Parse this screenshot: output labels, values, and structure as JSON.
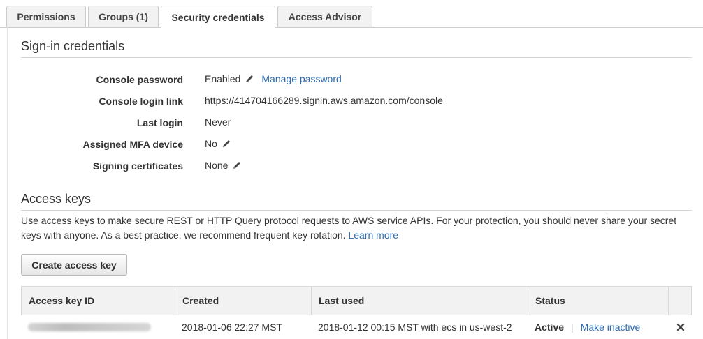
{
  "tabs": [
    {
      "label": "Permissions",
      "active": false
    },
    {
      "label": "Groups (1)",
      "active": false
    },
    {
      "label": "Security credentials",
      "active": true
    },
    {
      "label": "Access Advisor",
      "active": false
    }
  ],
  "signin": {
    "title": "Sign-in credentials",
    "console_password_label": "Console password",
    "console_password_value": "Enabled",
    "manage_password_link": "Manage password",
    "console_login_link_label": "Console login link",
    "console_login_link_value": "https://414704166289.signin.aws.amazon.com/console",
    "last_login_label": "Last login",
    "last_login_value": "Never",
    "mfa_label": "Assigned MFA device",
    "mfa_value": "No",
    "signing_certs_label": "Signing certificates",
    "signing_certs_value": "None"
  },
  "access_keys": {
    "title": "Access keys",
    "description": "Use access keys to make secure REST or HTTP Query protocol requests to AWS service APIs. For your protection, you should never share your secret keys with anyone. As a best practice, we recommend frequent key rotation.",
    "learn_more": "Learn more",
    "create_button": "Create access key",
    "columns": [
      "Access key ID",
      "Created",
      "Last used",
      "Status"
    ],
    "rows": [
      {
        "access_key_id": "",
        "created": "2018-01-06 22:27 MST",
        "last_used": "2018-01-12 00:15 MST with ecs in us-west-2",
        "status": "Active",
        "action": "Make inactive"
      }
    ]
  },
  "icons": {
    "edit": "pencil-icon",
    "delete": "close-icon"
  },
  "colors": {
    "link": "#2a6bb3",
    "header_bg": "#f2f2f2",
    "border": "#cccccc"
  }
}
